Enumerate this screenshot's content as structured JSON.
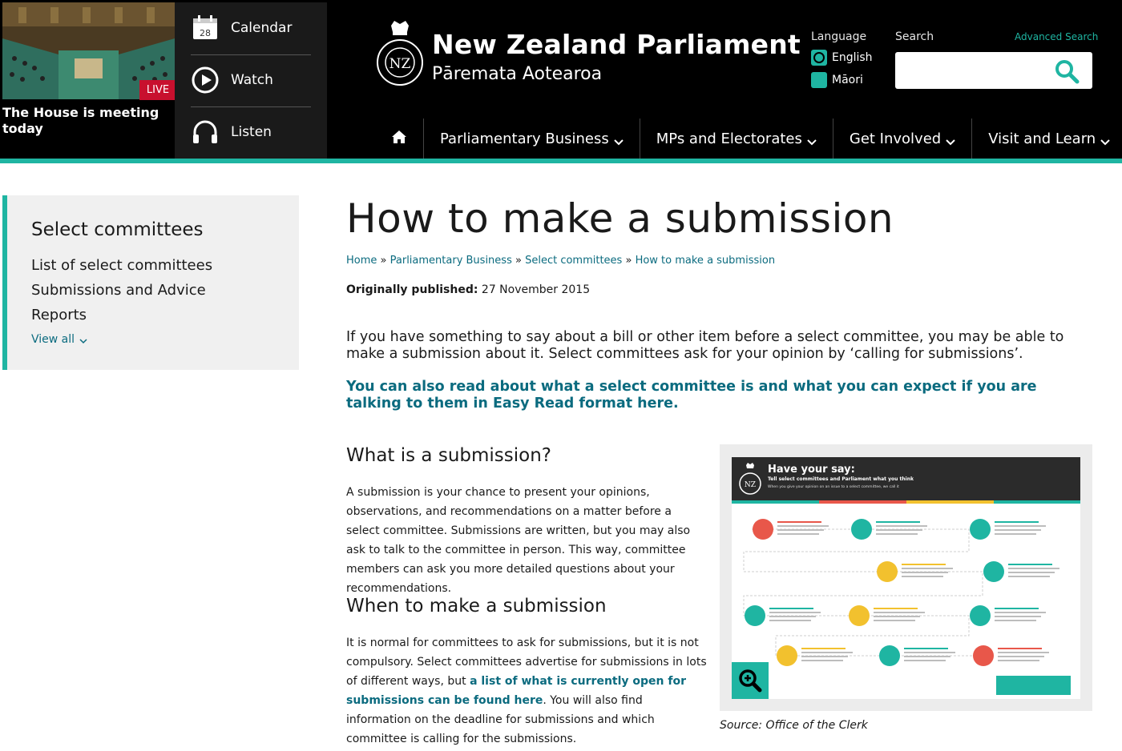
{
  "live": {
    "badge": "LIVE",
    "caption": "The House is meeting today"
  },
  "media": {
    "calendar_day": "28",
    "calendar_label": "Calendar",
    "watch_label": "Watch",
    "listen_label": "Listen"
  },
  "site": {
    "crest_text": "NZ",
    "title": "New Zealand Parliament",
    "subtitle": "Pāremata Aotearoa"
  },
  "language": {
    "label": "Language",
    "options": [
      "English",
      "Māori"
    ],
    "selected": "English"
  },
  "search": {
    "label": "Search",
    "advanced_label": "Advanced Search",
    "placeholder": ""
  },
  "nav": {
    "items": [
      "Parliamentary Business",
      "MPs and Electorates",
      "Get Involved",
      "Visit and Learn"
    ]
  },
  "sidebar": {
    "title": "Select committees",
    "links": [
      "List of select committees",
      "Submissions and Advice",
      "Reports"
    ],
    "view_all": "View all"
  },
  "page": {
    "title": "How to make a submission",
    "breadcrumb": [
      "Home",
      "Parliamentary Business",
      "Select committees",
      "How to make a submission"
    ],
    "published_label": "Originally published:",
    "published_date": "27 November 2015",
    "intro": "If you have something to say about a bill or other item before a select committee, you may be able to make a submission about it. Select committees ask for your opinion by ‘calling for submissions’.",
    "easy_read": "You can also read about what a select committee is and what you can expect if you are talking to them in Easy Read format here.",
    "section1_heading": "What is a submission?",
    "section1_text": "A submission is your chance to present your opinions, observations, and recommendations on a matter before a select committee. Submissions are written, but you may also ask to talk to the committee in person. This way, committee members can ask you more detailed questions about your recommendations.",
    "section2_heading": "When to make a submission",
    "section2_text_a": "It is normal for committees to ask for submissions, but it is not compulsory. Select committees advertise for submissions in lots of different ways, but ",
    "section2_link": "a list of what is currently open for submissions can be found here",
    "section2_text_b": ". You will also find information on the deadline for submissions and which committee is calling for the submissions."
  },
  "infographic": {
    "title": "Have your say:",
    "subtitle": "Tell select committees and Parliament what you think",
    "small_text": "When you give your opinion on an issue to a select committee, we call it",
    "caption": "Source: Office of the Clerk",
    "step_colors": [
      "#e8574a",
      "#1fb5a2",
      "#1fb5a2",
      "#f2c12e",
      "#1fb5a2",
      "#1fb5a2",
      "#f2c12e",
      "#1fb5a2",
      "#f2c12e",
      "#1fb5a2",
      "#e8574a",
      "#1fb5a2"
    ]
  },
  "colors": {
    "accent": "#1fb5a2",
    "link": "#0b6b7f",
    "live_red": "#c8102e"
  }
}
